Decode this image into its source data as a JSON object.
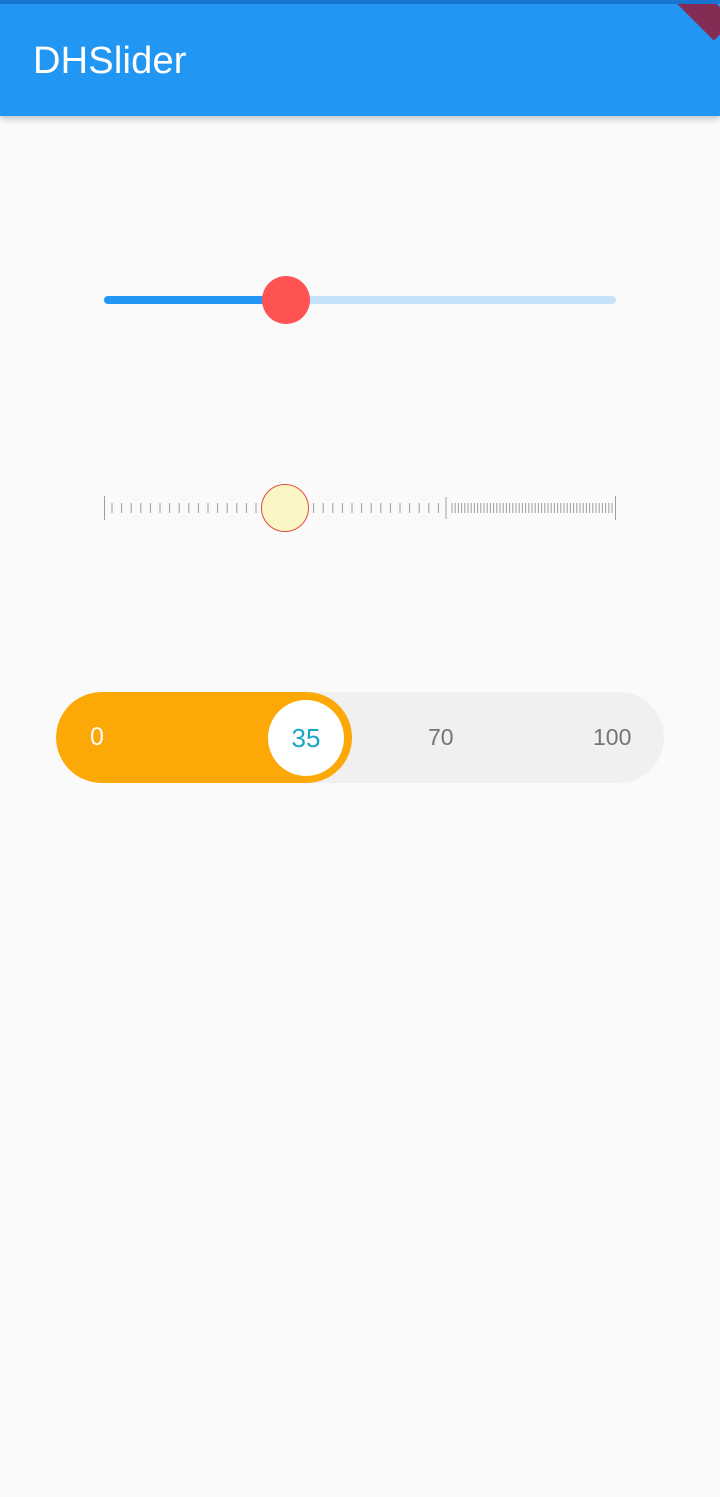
{
  "app_bar": {
    "title": "DHSlider",
    "color": "#2196f3"
  },
  "sliders": {
    "basic": {
      "value_fraction": 0.355,
      "active_color": "#2196f3",
      "inactive_color": "#c6e2f9",
      "thumb_color": "#ff5252"
    },
    "ruler": {
      "value_fraction": 0.355,
      "tick_color": "#9e9e9e",
      "thumb_fill": "#fbf7c4",
      "thumb_border": "#e04a3f"
    },
    "pill": {
      "value": "35",
      "value_fraction": 0.35,
      "labels": {
        "min": "0",
        "mid": "70",
        "max": "100"
      },
      "fill_color": "#fca806",
      "track_color": "#f0f0f0",
      "value_color": "#17a7c4"
    }
  }
}
